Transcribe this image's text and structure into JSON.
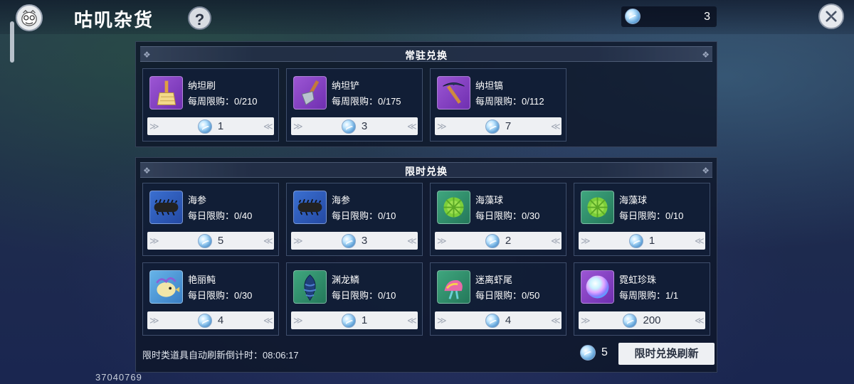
{
  "header": {
    "title": "咕叽杂货",
    "help_label": "?",
    "currency_amount": "3"
  },
  "sections": {
    "permanent": {
      "title": "常驻兑换",
      "items": [
        {
          "name": "纳坦刷",
          "limit": "每周限购：0/210",
          "price": "1",
          "icon": "brush-icon"
        },
        {
          "name": "纳坦铲",
          "limit": "每周限购：0/175",
          "price": "3",
          "icon": "shovel-icon"
        },
        {
          "name": "纳坦镐",
          "limit": "每周限购：0/112",
          "price": "7",
          "icon": "pickaxe-icon"
        }
      ]
    },
    "limited": {
      "title": "限时兑换",
      "items": [
        {
          "name": "海参",
          "limit": "每日限购：0/40",
          "price": "5",
          "icon": "sea-cucumber-icon"
        },
        {
          "name": "海参",
          "limit": "每日限购：0/10",
          "price": "3",
          "icon": "sea-cucumber-icon"
        },
        {
          "name": "海藻球",
          "limit": "每日限购：0/30",
          "price": "2",
          "icon": "seaweed-ball-icon"
        },
        {
          "name": "海藻球",
          "limit": "每日限购：0/10",
          "price": "1",
          "icon": "seaweed-ball-icon"
        },
        {
          "name": "艳丽鲀",
          "limit": "每日限购：0/30",
          "price": "4",
          "icon": "pufferfish-icon"
        },
        {
          "name": "渊龙鳞",
          "limit": "每日限购：0/10",
          "price": "1",
          "icon": "dragon-scale-icon"
        },
        {
          "name": "迷离虾尾",
          "limit": "每日限购：0/50",
          "price": "4",
          "icon": "shrimp-tail-icon"
        },
        {
          "name": "霓虹珍珠",
          "limit": "每周限购：1/1",
          "price": "200",
          "icon": "neon-pearl-icon"
        }
      ]
    }
  },
  "footer": {
    "refresh_countdown": "限时类道具自动刷新倒计时：08:06:17",
    "refresh_cost": "5",
    "refresh_button": "限时兑换刷新"
  },
  "uid": "37040769",
  "colors": {
    "card_bg": "#121e37",
    "price_bg": "#eef0f3",
    "accent_purple": "#9c56d4",
    "accent_blue": "#3a6fd0",
    "accent_green": "#3fa67e"
  }
}
